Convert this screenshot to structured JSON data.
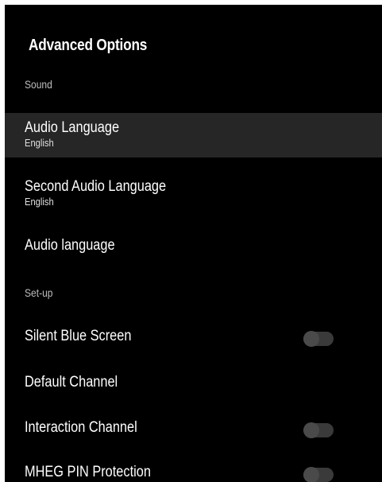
{
  "screen": {
    "title": "Advanced Options"
  },
  "sections": {
    "sound": {
      "header": "Sound",
      "audio_language": {
        "label": "Audio Language",
        "value": "English"
      },
      "second_audio_language": {
        "label": "Second Audio Language",
        "value": "English"
      },
      "audio_language_alt": {
        "label": "Audio language"
      }
    },
    "setup": {
      "header": "Set-up",
      "silent_blue_screen": {
        "label": "Silent Blue Screen",
        "state": "off"
      },
      "default_channel": {
        "label": "Default Channel"
      },
      "interaction_channel": {
        "label": "Interaction Channel",
        "state": "off"
      },
      "mheg_pin_protection": {
        "label": "MHEG PIN Protection",
        "state": "off"
      }
    }
  },
  "colors": {
    "background": "#000000",
    "focused_row": "#262626",
    "toggle_track_off": "#3a3a3a",
    "toggle_knob_off": "#4a4a4a",
    "text_primary": "#ffffff",
    "text_secondary": "#bdbdbd"
  },
  "focused_item": "Audio Language"
}
